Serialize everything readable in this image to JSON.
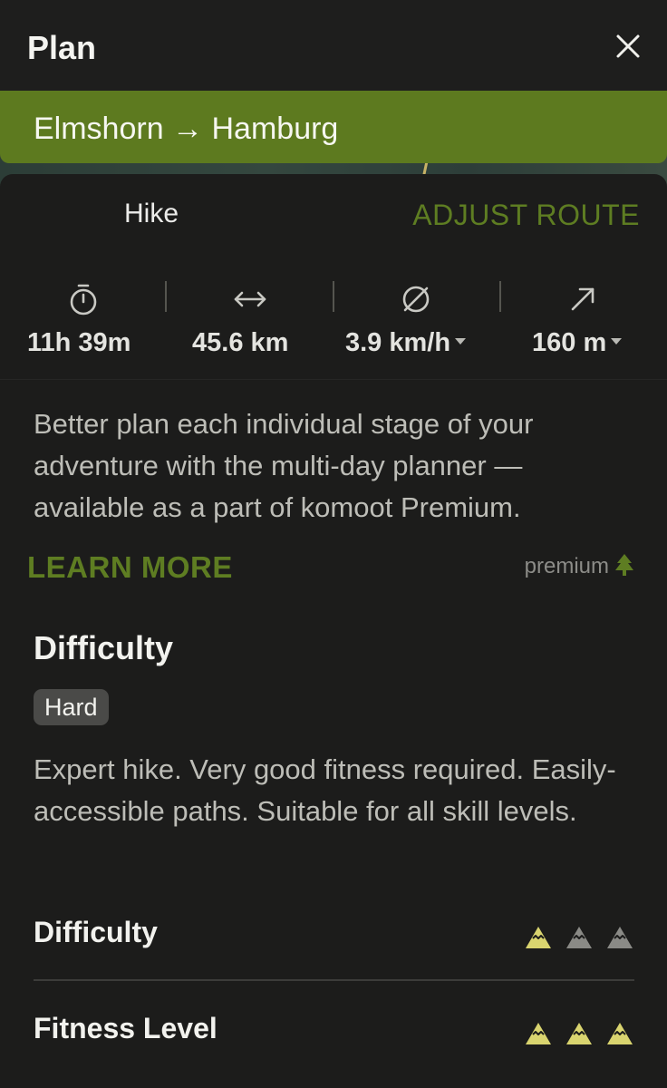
{
  "header": {
    "title": "Plan",
    "close_icon": "close-icon"
  },
  "route": {
    "label": "Elmshorn → Hamburg"
  },
  "card": {
    "sport": "Hike",
    "adjust_label": "ADJUST ROUTE",
    "stats": [
      {
        "icon": "stopwatch-icon",
        "value": "11h 39m",
        "has_dropdown": false
      },
      {
        "icon": "distance-arrows-icon",
        "value": "45.6 km",
        "has_dropdown": false
      },
      {
        "icon": "average-speed-icon",
        "value": "3.9 km/h",
        "has_dropdown": true
      },
      {
        "icon": "elevation-up-icon",
        "value": "160 m",
        "has_dropdown": true
      }
    ],
    "promo_text": "Better plan each individual stage of your adventure with the multi-day planner — available as a part of komoot Premium.",
    "learn_more": "LEARN MORE",
    "premium_label": "premium"
  },
  "difficulty": {
    "title": "Difficulty",
    "badge": "Hard",
    "description": "Expert hike. Very good fitness required. Easily-accessible paths. Suitable for all skill levels.",
    "ratings": [
      {
        "label": "Difficulty",
        "level": 1,
        "max": 3
      },
      {
        "label": "Fitness Level",
        "level": 3,
        "max": 3
      }
    ]
  },
  "colors": {
    "accent": "#5e7d22",
    "banner": "#5d7a1f",
    "background": "#1c1c1b",
    "mountain_active": "#d9d46f",
    "mountain_inactive": "#8a8a86"
  }
}
